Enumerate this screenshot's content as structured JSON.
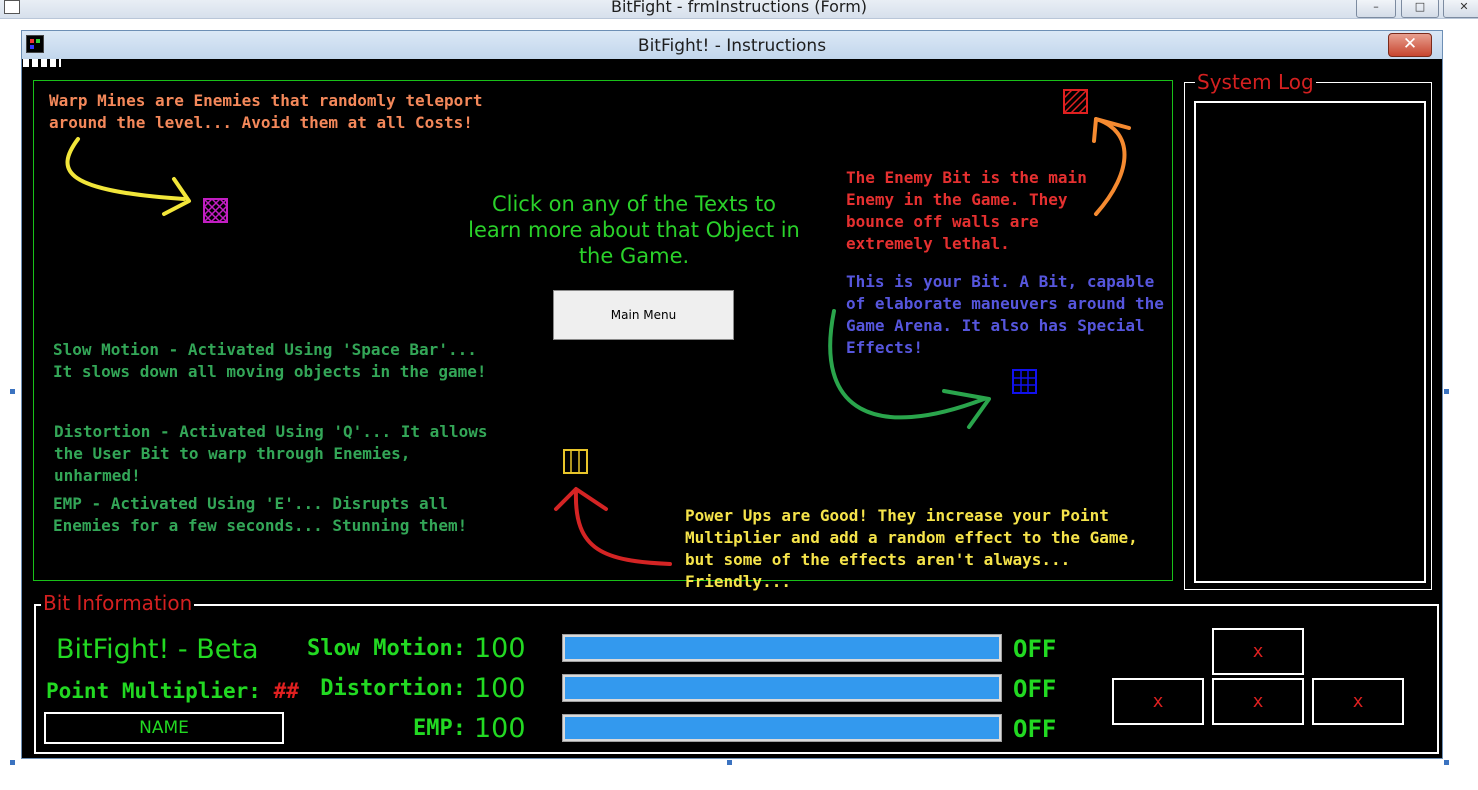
{
  "outer_window": {
    "title": "BitFight - frmInstructions (Form)"
  },
  "form": {
    "title": "BitFight! - Instructions",
    "close_glyph": "✕"
  },
  "main": {
    "warp_mines": "Warp Mines are Enemies that randomly teleport around the level... Avoid them at all Costs!",
    "instructions": "Click on any of the Texts to learn more about that Object in the Game.",
    "main_menu_button": "Main Menu",
    "enemy_bit": "The Enemy Bit is the main Enemy in the Game. They bounce off walls are extremely lethal.",
    "your_bit": "This is your Bit. A Bit, capable of elaborate maneuvers around the Game Arena. It also has Special Effects!",
    "slow_motion": "Slow Motion - Activated Using 'Space Bar'... It slows down all moving objects in the game!",
    "distortion": "Distortion - Activated Using 'Q'... It allows the User Bit to warp through Enemies, unharmed!",
    "emp": "EMP - Activated Using 'E'... Disrupts all Enemies for a few seconds... Stunning them!",
    "power_ups": "Power Ups are Good! They increase your Point Multiplier and add a random effect to the Game, but some of the effects aren't always... Friendly..."
  },
  "system_log": {
    "label": "System Log"
  },
  "bit_info": {
    "label": "Bit Information",
    "title": "BitFight! - Beta",
    "multiplier_label": "Point Multiplier:",
    "multiplier_value": "##",
    "name": "NAME",
    "stats": [
      {
        "label": "Slow Motion:",
        "value": "100",
        "status": "OFF",
        "level": 1.0
      },
      {
        "label": "Distortion:",
        "value": "100",
        "status": "OFF",
        "level": 1.0
      },
      {
        "label": "EMP:",
        "value": "100",
        "status": "OFF",
        "level": 1.0
      }
    ],
    "slots": [
      "x",
      "x",
      "x",
      "x"
    ]
  },
  "colors": {
    "warp": "#f4885a",
    "enemy": "#e53030",
    "your_bit": "#5656dd",
    "abilities": "#33a657",
    "powerups": "#f5e34a",
    "hud_green": "#22d922",
    "label_red": "#d42020",
    "bar_blue": "#3399ee"
  }
}
